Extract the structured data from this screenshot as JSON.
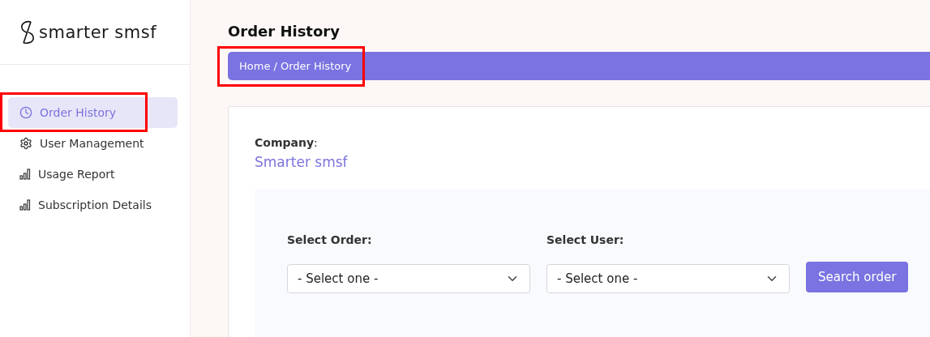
{
  "logo": {
    "text": "smarter smsf"
  },
  "sidebar": {
    "items": [
      {
        "label": "Order History",
        "selected": true
      },
      {
        "label": "User Management",
        "selected": false
      },
      {
        "label": "Usage Report",
        "selected": false
      },
      {
        "label": "Subscription Details",
        "selected": false
      }
    ]
  },
  "page": {
    "title": "Order History"
  },
  "breadcrumb": [
    "Home",
    "/ Order History"
  ],
  "company": {
    "label": "**Company**:",
    "value": "Smarter smsf"
  },
  "filters": [
    {
      "label": "Select Order:",
      "value": "- Select one -"
    },
    {
      "label": "Select User:",
      "value": "- Select one -"
    }
  ],
  "search_button": "Search order"
}
